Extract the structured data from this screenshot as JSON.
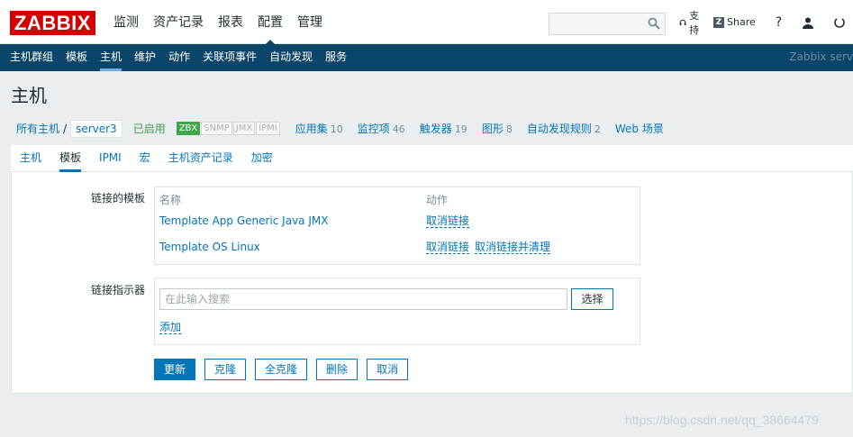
{
  "app": {
    "logo_text": "ZABBIX"
  },
  "topnav": [
    {
      "label": "监测",
      "selected": false
    },
    {
      "label": "资产记录",
      "selected": false
    },
    {
      "label": "报表",
      "selected": false
    },
    {
      "label": "配置",
      "selected": true
    },
    {
      "label": "管理",
      "selected": false
    }
  ],
  "header_links": {
    "support": "支持",
    "share": "Share",
    "help": "?"
  },
  "search": {
    "placeholder": ""
  },
  "subnav": {
    "items": [
      "主机群组",
      "模板",
      "主机",
      "维护",
      "动作",
      "关联项事件",
      "自动发现",
      "服务"
    ],
    "selected_index": 2,
    "brand": "Zabbix serv"
  },
  "page": {
    "title": "主机"
  },
  "breadcrumb": {
    "all_hosts": "所有主机",
    "separator": "/",
    "current": "server3",
    "status": "已启用",
    "badges": [
      {
        "label": "ZBX",
        "active": true
      },
      {
        "label": "SNMP",
        "active": false
      },
      {
        "label": "JMX",
        "active": false
      },
      {
        "label": "IPMI",
        "active": false
      }
    ],
    "links": [
      {
        "label": "应用集",
        "count": "10"
      },
      {
        "label": "监控项",
        "count": "46"
      },
      {
        "label": "触发器",
        "count": "19"
      },
      {
        "label": "图形",
        "count": "8"
      },
      {
        "label": "自动发现规则",
        "count": "2"
      },
      {
        "label": "Web 场景",
        "count": ""
      }
    ]
  },
  "tabs": [
    {
      "label": "主机",
      "selected": false
    },
    {
      "label": "模板",
      "selected": true
    },
    {
      "label": "IPMI",
      "selected": false
    },
    {
      "label": "宏",
      "selected": false
    },
    {
      "label": "主机资产记录",
      "selected": false
    },
    {
      "label": "加密",
      "selected": false
    }
  ],
  "linked_templates": {
    "label": "链接的模板",
    "col_name": "名称",
    "col_action": "动作",
    "rows": [
      {
        "name": "Template App Generic Java JMX",
        "unlink": "取消链接",
        "unlink_clear": ""
      },
      {
        "name": "Template OS Linux",
        "unlink": "取消链接",
        "unlink_clear": "取消链接并清理"
      }
    ]
  },
  "link_new": {
    "label": "链接指示器",
    "placeholder": "在此输入搜索",
    "select_button": "选择",
    "add_link": "添加"
  },
  "buttons": {
    "update": "更新",
    "clone": "克隆",
    "full_clone": "全克隆",
    "delete": "删除",
    "cancel": "取消"
  },
  "watermark": "https://blog.csdn.net/qq_38664479"
}
